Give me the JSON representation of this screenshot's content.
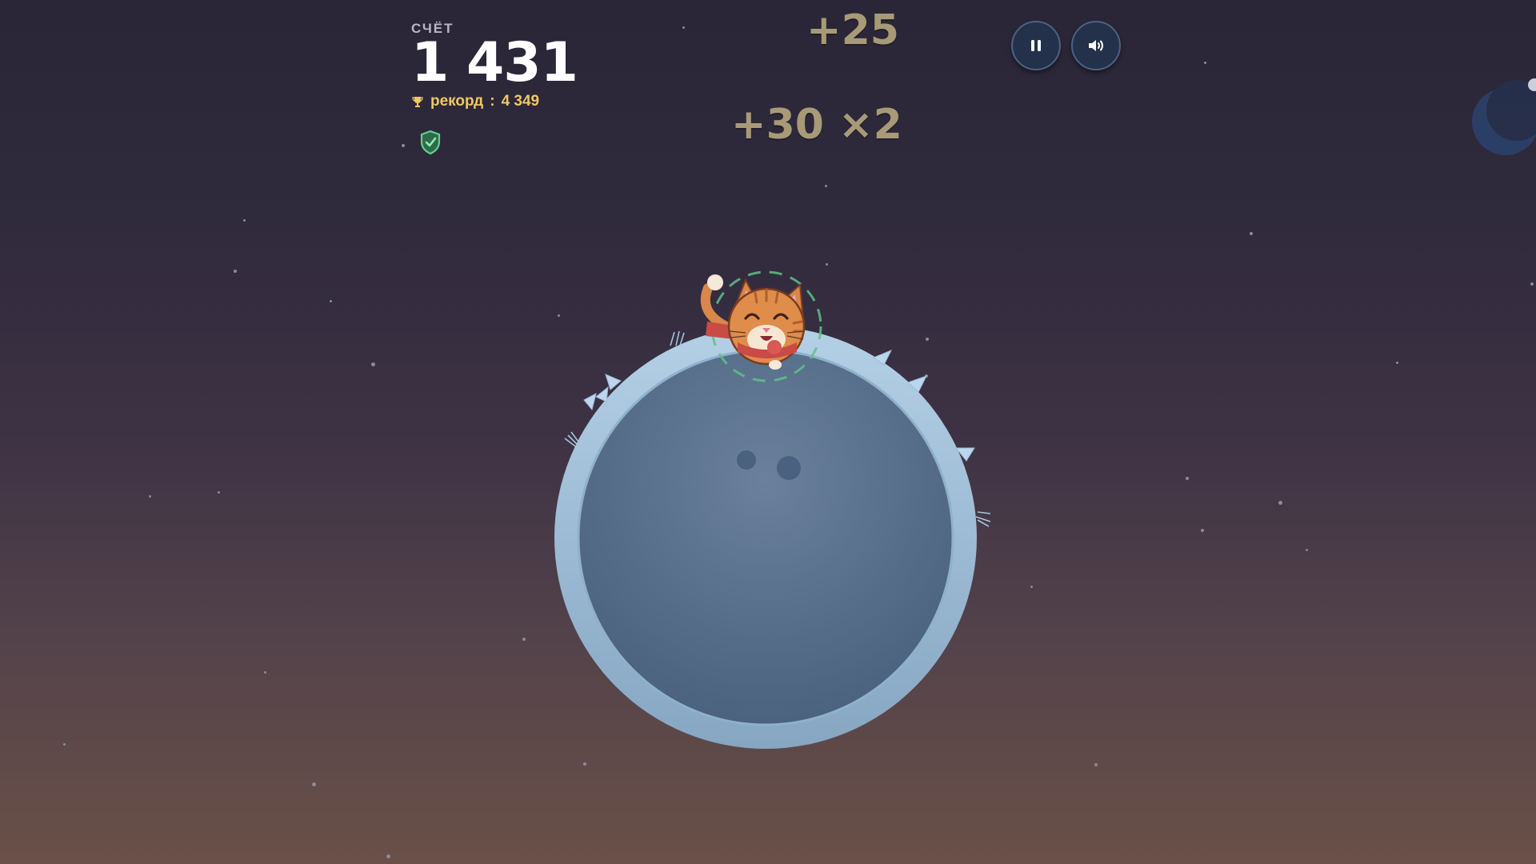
{
  "hud": {
    "score_label": "СЧЁТ",
    "score_value": "1 431",
    "record_label": "рекорд",
    "record_separator": ":",
    "record_value": "4 349"
  },
  "popups": {
    "first": "+25",
    "second": "+30 ×2"
  },
  "controls": {
    "pause_icon": "pause-icon",
    "sound_icon": "speaker-icon"
  },
  "icons": {
    "trophy": "trophy-icon",
    "shield": "shield-check-icon"
  },
  "colors": {
    "accent_gold": "#f0c766",
    "shield_green": "#5fd38a",
    "planet_rim": "#a7c4dc",
    "planet_core": "#526882",
    "popup_text": "#a89a76"
  }
}
